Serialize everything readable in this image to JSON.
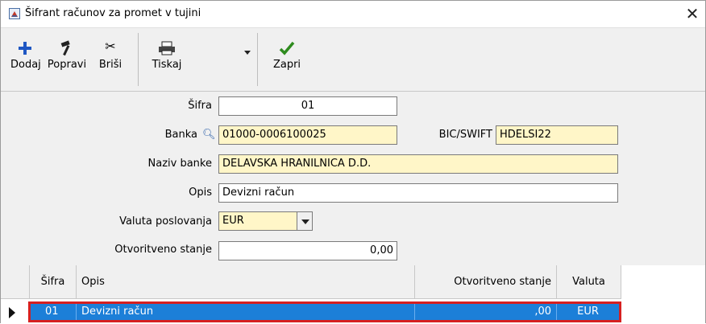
{
  "window": {
    "title": "Šifrant računov za promet v tujini",
    "close_glyph": "✕"
  },
  "toolbar": {
    "add_label": "Dodaj",
    "edit_label": "Popravi",
    "delete_label": "Briši",
    "print_label": "Tiskaj",
    "close_label": "Zapri",
    "icons": {
      "add": "plus-icon",
      "edit": "hammer-icon",
      "delete": "scissors-icon",
      "print": "printer-icon",
      "close": "checkmark-icon"
    },
    "colors": {
      "add": "#1f57c3",
      "close": "#2e8b1e"
    }
  },
  "form": {
    "sifra_label": "Šifra",
    "sifra_value": "01",
    "banka_label": "Banka",
    "banka_value": "01000-0006100025",
    "bic_label": "BIC/SWIFT",
    "bic_value": "HDELSI22",
    "naziv_label": "Naziv banke",
    "naziv_value": "DELAVSKA HRANILNICA D.D.",
    "opis_label": "Opis",
    "opis_value": "Devizni račun",
    "valuta_label": "Valuta poslovanja",
    "valuta_value": "EUR",
    "stanje_label": "Otvoritveno stanje",
    "stanje_value": "0,00"
  },
  "table": {
    "columns": [
      "Šifra",
      "Opis",
      "Otvoritveno stanje",
      "Valuta"
    ],
    "rows": [
      {
        "sifra": "01",
        "opis": "Devizni račun",
        "stanje": ",00",
        "valuta": "EUR",
        "selected": true
      }
    ]
  },
  "colors": {
    "selection": "#1c7fd8",
    "highlight_border": "#d62020",
    "required_field": "#fff6c8"
  }
}
